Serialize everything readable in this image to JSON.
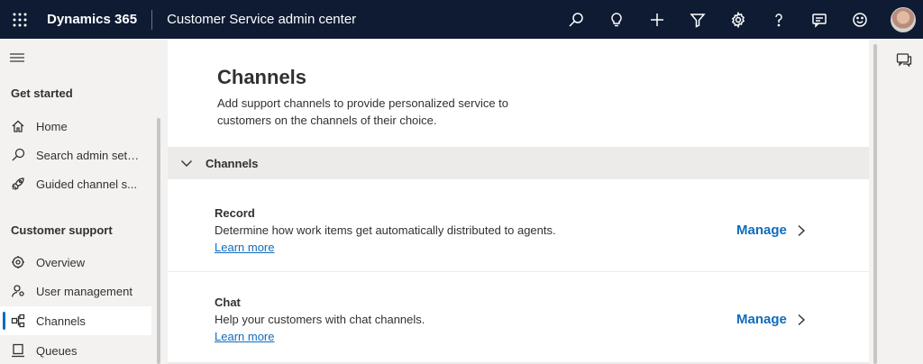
{
  "topbar": {
    "brand": "Dynamics 365",
    "app_name": "Customer Service admin center",
    "icons": [
      "waffle-icon",
      "search-icon",
      "lightbulb-icon",
      "plus-icon",
      "filter-icon",
      "gear-icon",
      "help-icon",
      "feedback-icon",
      "smiley-icon",
      "avatar"
    ]
  },
  "sidebar": {
    "sections": [
      {
        "title": "Get started",
        "items": [
          {
            "label": "Home",
            "icon": "home-icon"
          },
          {
            "label": "Search admin sett...",
            "icon": "search-icon"
          },
          {
            "label": "Guided channel s...",
            "icon": "rocket-icon"
          }
        ]
      },
      {
        "title": "Customer support",
        "items": [
          {
            "label": "Overview",
            "icon": "overview-icon"
          },
          {
            "label": "User management",
            "icon": "user-icon"
          },
          {
            "label": "Channels",
            "icon": "channels-icon",
            "active": true
          },
          {
            "label": "Queues",
            "icon": "queues-icon"
          }
        ]
      }
    ]
  },
  "main": {
    "title": "Channels",
    "description": "Add support channels to provide personalized service to customers on the channels of their choice.",
    "group": {
      "title": "Channels",
      "rows": [
        {
          "title": "Record",
          "description": "Determine how work items get automatically distributed to agents.",
          "link": "Learn more",
          "action": "Manage"
        },
        {
          "title": "Chat",
          "description": "Help your customers with chat channels.",
          "link": "Learn more",
          "action": "Manage"
        }
      ]
    }
  },
  "right_rail": {
    "icon": "chat-icon"
  },
  "colors": {
    "topbar_bg": "#0e1b33",
    "accent": "#0f6cbd",
    "sidebar_bg": "#f3f2f1"
  }
}
